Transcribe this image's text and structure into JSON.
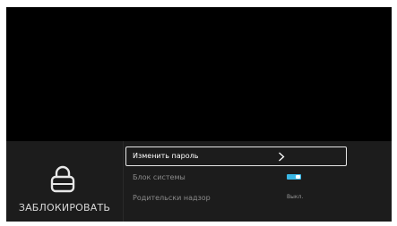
{
  "lock_panel": {
    "icon": "padlock-icon",
    "label": "ЗАБЛОКИРОВАТЬ"
  },
  "menu": {
    "items": [
      {
        "label": "Изменить пароль",
        "control": "chevron-right-icon",
        "selected": true
      },
      {
        "label": "Блок системы",
        "control": "toggle",
        "toggle_on": true
      },
      {
        "label": "Родительски надзор",
        "value": "Выкл."
      }
    ]
  },
  "colors": {
    "screen_bg": "#000000",
    "panel_bg": "#1c1c1c",
    "accent": "#39b7e5",
    "selected_border": "#e6e6e6"
  }
}
